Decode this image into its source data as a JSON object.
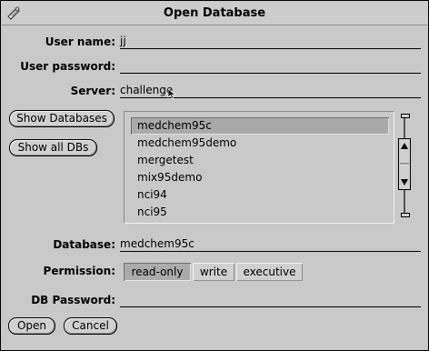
{
  "window": {
    "title": "Open Database"
  },
  "form": {
    "user_name_label": "User name:",
    "user_name_value": "jj",
    "user_password_label": "User password:",
    "user_password_value": "",
    "server_label": "Server:",
    "server_value": "challenge",
    "database_label": "Database:",
    "database_value": "medchem95c",
    "permission_label": "Permission:",
    "db_password_label": "DB Password:",
    "db_password_value": ""
  },
  "buttons": {
    "show_databases": "Show Databases",
    "show_all_dbs": "Show all DBs",
    "open": "Open",
    "cancel": "Cancel"
  },
  "database_list": {
    "items": [
      "medchem95c",
      "medchem95demo",
      "mergetest",
      "mix95demo",
      "nci94",
      "nci95"
    ],
    "selected": "medchem95c"
  },
  "permission": {
    "options": [
      "read-only",
      "write",
      "executive"
    ],
    "selected": "read-only"
  },
  "colors": {
    "window_bg": "#c9c9c9",
    "selected_bg": "#a9a9a9"
  }
}
